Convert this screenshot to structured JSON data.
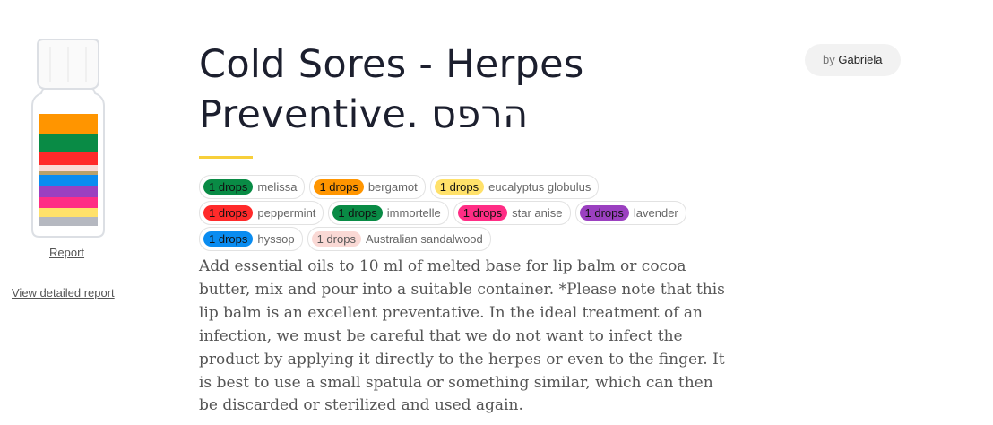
{
  "sidebar": {
    "report_label": "Report",
    "detail_label": "View detailed report",
    "bottle_icon": "oil-bottle-icon",
    "bottle_bands": [
      "#ff9500",
      "#098b45",
      "#ff2a2a",
      "#fad9d5",
      "#b9a16b",
      "#0a8cf0",
      "#9b40c0",
      "#ff2d85",
      "#ffe16a",
      "#b5b8c0"
    ]
  },
  "recipe": {
    "title_line1": "Cold Sores - Herpes",
    "title_line2": "Preventive. הרפס",
    "author_prefix": "by",
    "author_name": "Gabriela",
    "accent_color": "#f7cf3b",
    "description": "Add essential oils to 10 ml of melted base for lip balm or cocoa butter, mix and pour into a suitable container. *Please note that this lip balm is an excellent preventative. In the ideal treatment of an infection, we must be careful that we do not want to infect the product by applying it directly to the herpes or even to the finger. It is best to use a small spatula or something similar, which can then be discarded or sterilized and used again."
  },
  "ingredients": [
    {
      "drops": "1 drops",
      "name": "melissa",
      "color": "#098b45",
      "text": "#111111"
    },
    {
      "drops": "1 drops",
      "name": "bergamot",
      "color": "#ff9500",
      "text": "#111111"
    },
    {
      "drops": "1 drops",
      "name": "eucalyptus globulus",
      "color": "#ffe16a",
      "text": "#111111"
    },
    {
      "drops": "1 drops",
      "name": "peppermint",
      "color": "#ff2a2a",
      "text": "#111111"
    },
    {
      "drops": "1 drops",
      "name": "immortelle",
      "color": "#098b45",
      "text": "#111111"
    },
    {
      "drops": "1 drops",
      "name": "star anise",
      "color": "#ff2d85",
      "text": "#111111"
    },
    {
      "drops": "1 drops",
      "name": "lavender",
      "color": "#9b40c0",
      "text": "#111111"
    },
    {
      "drops": "1 drops",
      "name": "hyssop",
      "color": "#0a8cf0",
      "text": "#111111"
    },
    {
      "drops": "1 drops",
      "name": "Australian sandalwood",
      "color": "#fad9d5",
      "text": "#555555"
    }
  ]
}
